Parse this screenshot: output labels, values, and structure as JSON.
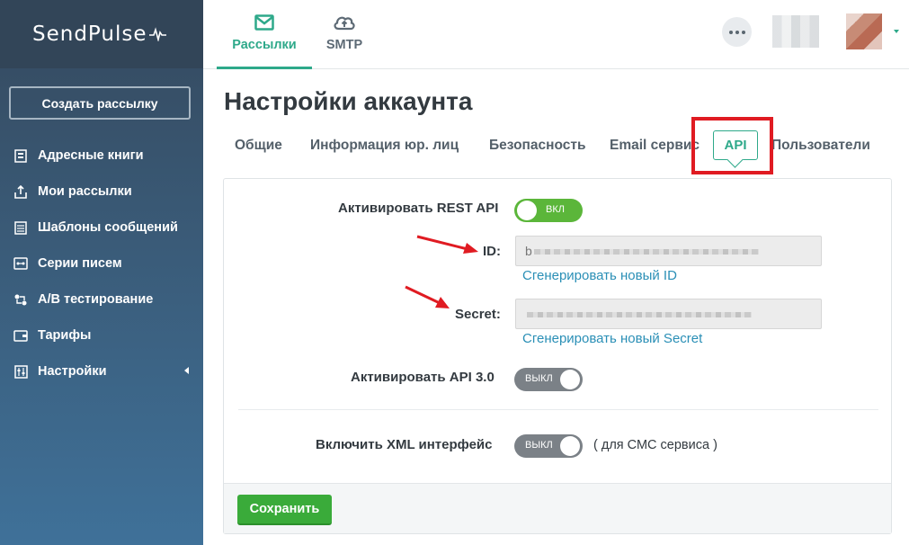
{
  "app": {
    "logo": "SendPulse"
  },
  "sidebar": {
    "create_button": "Создать рассылку",
    "items": [
      {
        "label": "Адресные книги",
        "icon": "address-book-icon"
      },
      {
        "label": "Мои рассылки",
        "icon": "mailing-icon"
      },
      {
        "label": "Шаблоны сообщений",
        "icon": "template-icon"
      },
      {
        "label": "Серии писем",
        "icon": "series-icon"
      },
      {
        "label": "A/B тестирование",
        "icon": "ab-test-icon"
      },
      {
        "label": "Тарифы",
        "icon": "wallet-icon"
      },
      {
        "label": "Настройки",
        "icon": "settings-icon"
      }
    ]
  },
  "header": {
    "tabs": [
      {
        "label": "Рассылки",
        "icon": "envelope-icon",
        "active": true
      },
      {
        "label": "SMTP",
        "icon": "cloud-upload-icon",
        "active": false
      }
    ],
    "more_icon": "dots-icon"
  },
  "page": {
    "title": "Настройки аккаунта",
    "tabs": [
      {
        "label": "Общие"
      },
      {
        "label": "Информация юр. лиц"
      },
      {
        "label": "Безопасность"
      },
      {
        "label": "Email сервис"
      },
      {
        "label": "API",
        "active": true
      },
      {
        "label": "Пользователи"
      }
    ]
  },
  "form": {
    "rest_api": {
      "label": "Активировать REST API",
      "state": "ВКЛ"
    },
    "id": {
      "label": "ID:",
      "value": "b",
      "regenerate": "Сгенерировать новый ID"
    },
    "secret": {
      "label": "Secret:",
      "regenerate": "Сгенерировать новый Secret"
    },
    "api3": {
      "label": "Активировать API 3.0",
      "state": "ВЫКЛ"
    },
    "xml": {
      "label": "Включить XML интерфейс",
      "state": "ВЫКЛ",
      "note": "( для СМС сервиса )"
    },
    "save_button": "Сохранить"
  },
  "colors": {
    "accent": "#2ea98a",
    "toggle_on": "#5bb63a",
    "toggle_off": "#7b8187",
    "save": "#3aab3a",
    "highlight": "#e01b22",
    "link": "#2a8fb6"
  }
}
